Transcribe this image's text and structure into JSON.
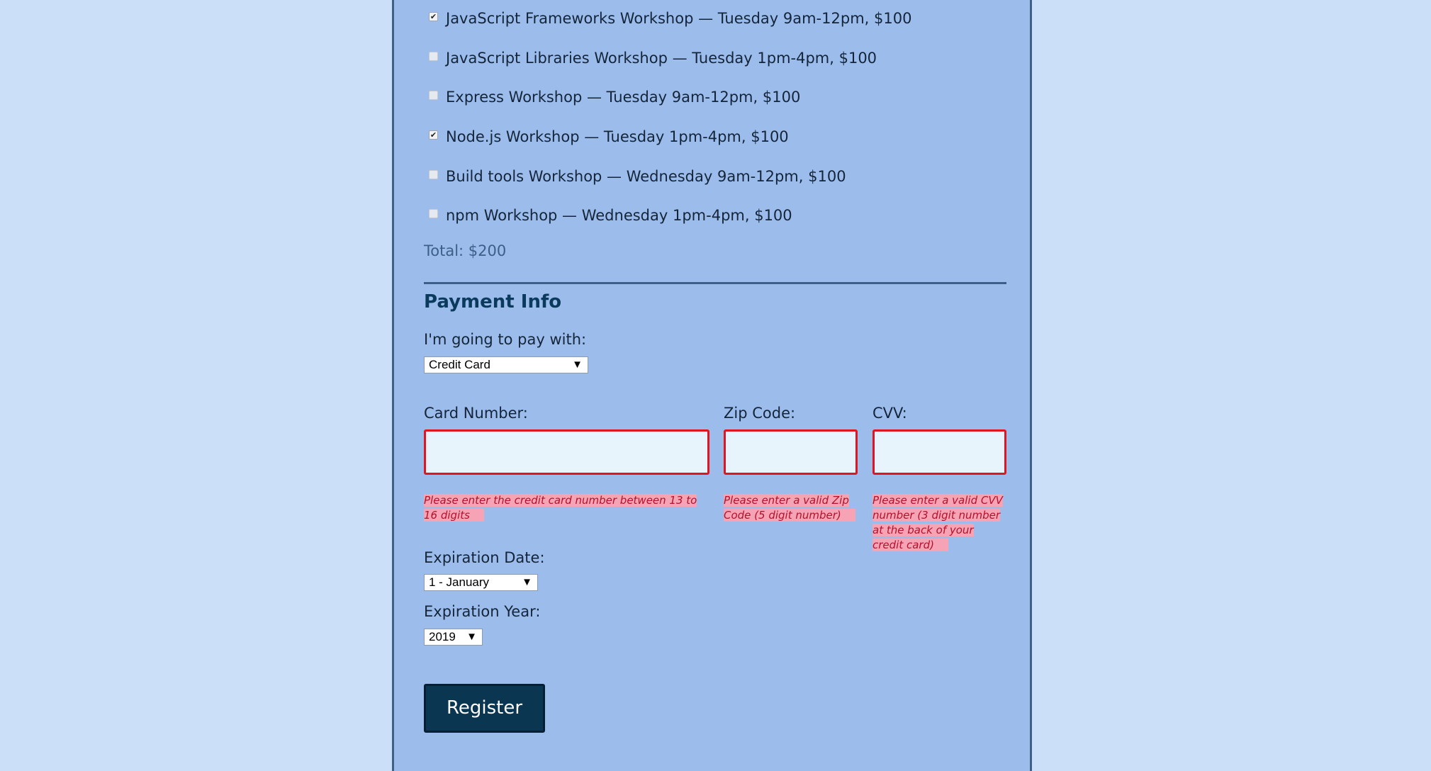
{
  "activities": [
    {
      "label": "JavaScript Frameworks Workshop — Tuesday 9am-12pm, $100",
      "checked": true
    },
    {
      "label": "JavaScript Libraries Workshop — Tuesday 1pm-4pm, $100",
      "checked": false
    },
    {
      "label": "Express Workshop — Tuesday 9am-12pm, $100",
      "checked": false
    },
    {
      "label": "Node.js Workshop — Tuesday 1pm-4pm, $100",
      "checked": true
    },
    {
      "label": "Build tools Workshop — Wednesday 9am-12pm, $100",
      "checked": false
    },
    {
      "label": "npm Workshop — Wednesday 1pm-4pm, $100",
      "checked": false
    }
  ],
  "total": "Total: $200",
  "payment": {
    "title": "Payment Info",
    "pay_with_label": "I'm going to pay with:",
    "pay_with_value": "Credit Card",
    "card_number_label": "Card Number:",
    "zip_label": "Zip Code:",
    "cvv_label": "CVV:",
    "card_number_value": "",
    "zip_value": "",
    "cvv_value": "",
    "card_number_error": "Please enter the credit card number between 13 to 16 digits",
    "zip_error": "Please enter a valid Zip Code (5 digit number)",
    "cvv_error": "Please enter a valid CVV number (3 digit number at the back of your credit card)",
    "exp_date_label": "Expiration Date:",
    "exp_date_value": "1 - January",
    "exp_year_label": "Expiration Year:",
    "exp_year_value": "2019"
  },
  "register_label": "Register",
  "colors": {
    "page_bg": "#cbdff9",
    "form_bg": "#9cbdec",
    "accent": "#0a3651",
    "error_border": "#e0151f",
    "error_bg": "#f5a3b5"
  }
}
